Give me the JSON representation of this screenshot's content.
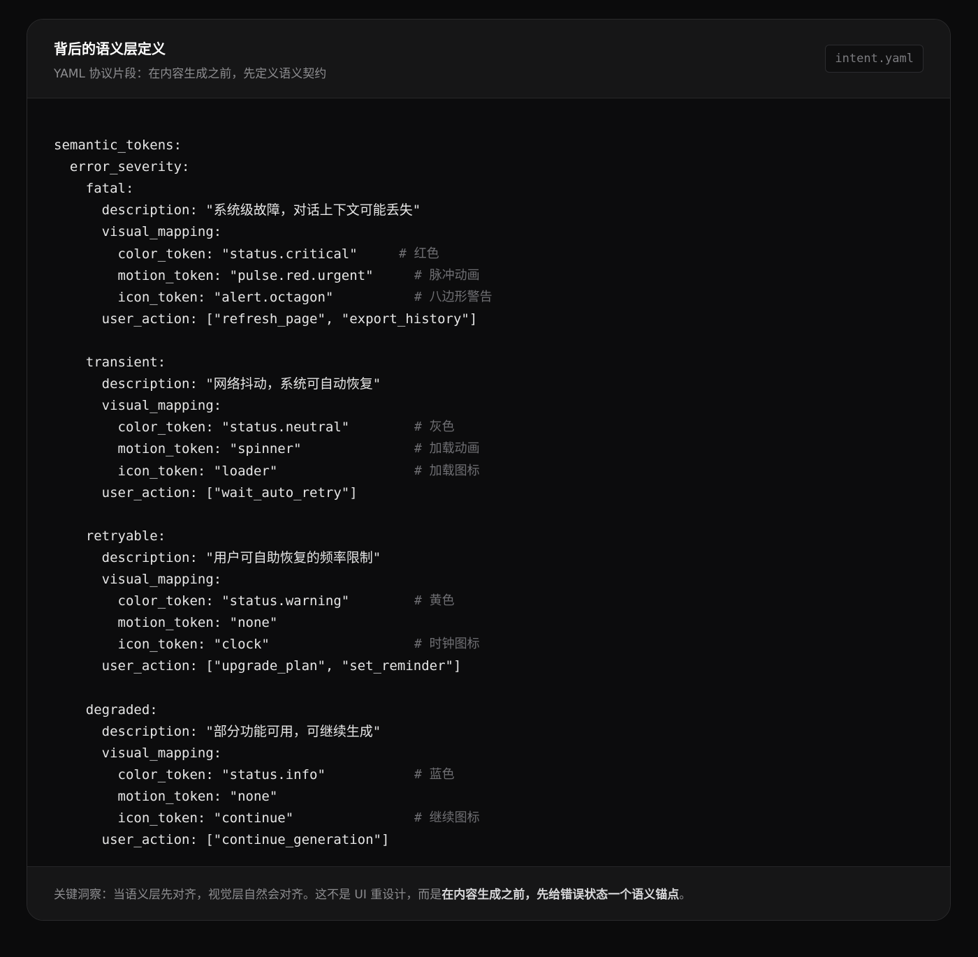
{
  "header": {
    "title": "背后的语义层定义",
    "subtitle": "YAML 协议片段：在内容生成之前，先定义语义契约",
    "file_badge": "intent.yaml"
  },
  "code": {
    "lines": [
      "semantic_tokens:",
      "  error_severity:",
      "    fatal:",
      "      description: \"系统级故障，对话上下文可能丢失\"",
      "      visual_mapping:",
      "        color_token: \"status.critical\"",
      "        motion_token: \"pulse.red.urgent\"",
      "        icon_token: \"alert.octagon\"",
      "      user_action: [\"refresh_page\", \"export_history\"]",
      "",
      "    transient:",
      "      description: \"网络抖动，系统可自动恢复\"",
      "      visual_mapping:",
      "        color_token: \"status.neutral\"",
      "        motion_token: \"spinner\"",
      "        icon_token: \"loader\"",
      "      user_action: [\"wait_auto_retry\"]",
      "",
      "    retryable:",
      "      description: \"用户可自助恢复的频率限制\"",
      "      visual_mapping:",
      "        color_token: \"status.warning\"",
      "        motion_token: \"none\"",
      "        icon_token: \"clock\"",
      "      user_action: [\"upgrade_plan\", \"set_reminder\"]",
      "",
      "    degraded:",
      "      description: \"部分功能可用，可继续生成\"",
      "      visual_mapping:",
      "        color_token: \"status.info\"",
      "        motion_token: \"none\"",
      "        icon_token: \"continue\"",
      "      user_action: [\"continue_generation\"]"
    ],
    "comments": [
      {
        "line": 5,
        "text": "# 红色"
      },
      {
        "line": 6,
        "text": "# 脉冲动画"
      },
      {
        "line": 7,
        "text": "# 八边形警告"
      },
      {
        "line": 13,
        "text": "# 灰色"
      },
      {
        "line": 14,
        "text": "# 加载动画"
      },
      {
        "line": 15,
        "text": "# 加载图标"
      },
      {
        "line": 21,
        "text": "# 黄色"
      },
      {
        "line": 23,
        "text": "# 时钟图标"
      },
      {
        "line": 29,
        "text": "# 蓝色"
      },
      {
        "line": 31,
        "text": "# 继续图标"
      }
    ]
  },
  "footer": {
    "prefix": "关键洞察：当语义层先对齐，视觉层自然会对齐。这不是 UI 重设计，而是",
    "emphasis": "在内容生成之前，先给错误状态一个语义锚点",
    "suffix": "。"
  },
  "colors": {
    "background": "#0b0b0c",
    "card": "#0c0c0d",
    "header": "#161617",
    "text": "#e6e6e6",
    "muted": "#8d8d90",
    "comment": "#6f6f73"
  }
}
